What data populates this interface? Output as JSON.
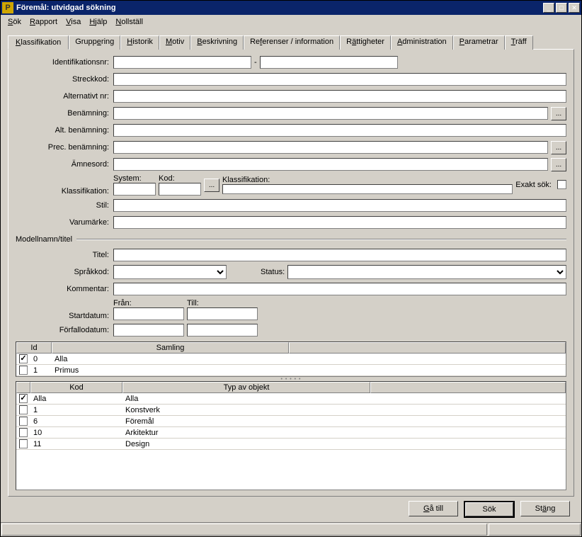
{
  "window": {
    "title": "Föremål: utvidgad sökning"
  },
  "menu": {
    "sok": "Sök",
    "rapport": "Rapport",
    "visa": "Visa",
    "hjalp": "Hjälp",
    "nollstall": "Nollställ"
  },
  "tabs": {
    "klassifikation": "Klassifikation",
    "gruppering": "Gruppering",
    "historik": "Historik",
    "motiv": "Motiv",
    "beskrivning": "Beskrivning",
    "referenser": "Referenser / information",
    "rattigheter": "Rättigheter",
    "administration": "Administration",
    "parametrar": "Parametrar",
    "traff": "Träff"
  },
  "labels": {
    "identifikationsnr": "Identifikationsnr:",
    "streckkod": "Streckkod:",
    "alternativt_nr": "Alternativt nr:",
    "benamning": "Benämning:",
    "alt_benamning": "Alt. benämning:",
    "prec_benamning": "Prec. benämning:",
    "amnesord": "Ämnesord:",
    "klassifikation": "Klassifikation:",
    "system": "System:",
    "kod": "Kod:",
    "klass_inner": "Klassifikation:",
    "exakt_sok": "Exakt sök:",
    "stil": "Stil:",
    "varumarke": "Varumärke:",
    "modellnamn": "Modellnamn/titel",
    "titel": "Titel:",
    "sprakkod": "Språkkod:",
    "status": "Status:",
    "kommentar": "Kommentar:",
    "fran": "Från:",
    "till": "Till:",
    "startdatum": "Startdatum:",
    "forfallodatum": "Förfallodatum:"
  },
  "table1": {
    "headers": {
      "id": "Id",
      "samling": "Samling"
    },
    "rows": [
      {
        "checked": true,
        "id": "0",
        "samling": "Alla"
      },
      {
        "checked": false,
        "id": "1",
        "samling": "Primus"
      }
    ]
  },
  "table2": {
    "headers": {
      "kod": "Kod",
      "typ": "Typ av objekt"
    },
    "rows": [
      {
        "checked": true,
        "kod": "Alla",
        "typ": "Alla"
      },
      {
        "checked": false,
        "kod": "1",
        "typ": "Konstverk"
      },
      {
        "checked": false,
        "kod": "6",
        "typ": "Föremål"
      },
      {
        "checked": false,
        "kod": "10",
        "typ": "Arkitektur"
      },
      {
        "checked": false,
        "kod": "11",
        "typ": "Design"
      }
    ]
  },
  "buttons": {
    "gatill": "Gå till",
    "sok": "Sök",
    "stang": "Stäng"
  },
  "ellipsis": "..."
}
